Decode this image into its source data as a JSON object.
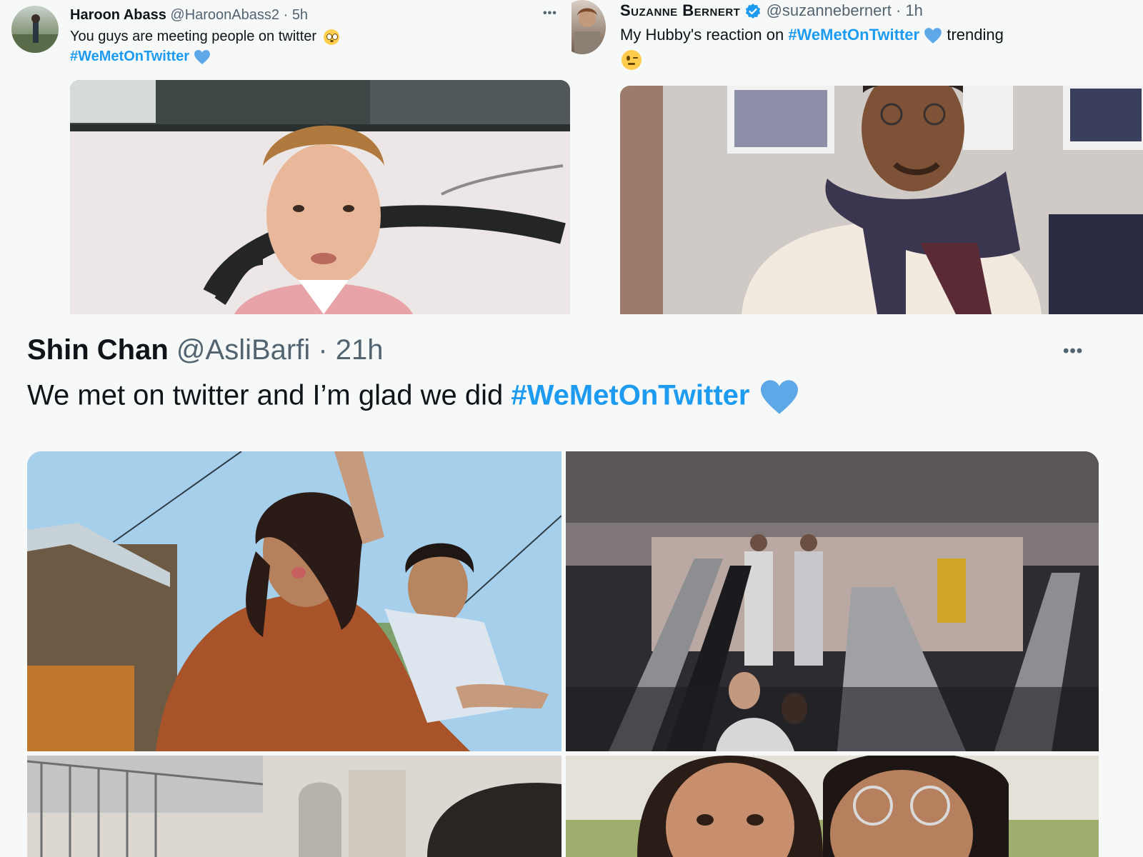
{
  "tweets": [
    {
      "name": "Haroon Abass",
      "handle": "@HaroonAbass2",
      "sep": "·",
      "time": "5h",
      "text": "You guys are meeting people on twitter",
      "emoji": "flushed-face",
      "hashtag": "#WeMetOnTwitter"
    },
    {
      "name": "Suzanne Bernert",
      "handle": "@suzannebernert",
      "sep": "·",
      "time": "1h",
      "text_before": "My Hubby's reaction on ",
      "hashtag": "#WeMetOnTwitter",
      "text_after": "trending",
      "emoji": "winking-face"
    },
    {
      "name": "Shin Chan",
      "handle": "@AsliBarfi",
      "sep": "·",
      "time": "21h",
      "text": "We met on twitter and I’m glad we did ",
      "hashtag": "#WeMetOnTwitter"
    }
  ],
  "more_label": "•••",
  "colors": {
    "hashtag": "#1d9bf0",
    "heart": "#5fa8e8",
    "verified": "#1d9bf0"
  },
  "icons": [
    "blue-heart-icon",
    "verified-badge-icon",
    "more-icon",
    "flushed-face-icon",
    "winking-face-icon"
  ]
}
